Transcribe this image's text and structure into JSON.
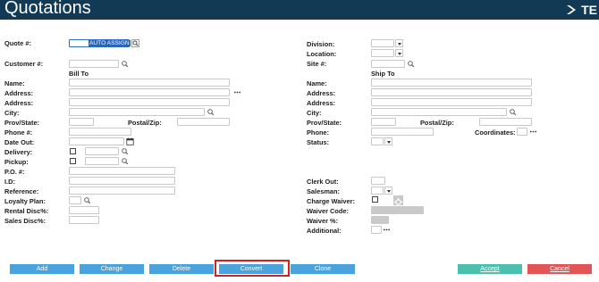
{
  "header": {
    "title": "Quotations",
    "logo_text": "TE"
  },
  "left": {
    "quote_label": "Quote #:",
    "quote_value": "AUTO ASSIGN",
    "customer_label": "Customer #:",
    "bill_to_heading": "Bill To",
    "name_label": "Name:",
    "address1_label": "Address:",
    "address2_label": "Address:",
    "city_label": "City:",
    "prov_label": "Prov/State:",
    "postal_label": "Postal/Zip:",
    "phone_label": "Phone #:",
    "date_out_label": "Date Out:",
    "delivery_label": "Delivery:",
    "pickup_label": "Pickup:",
    "po_label": "P.O. #:",
    "id_label": "I.D:",
    "reference_label": "Reference:",
    "loyalty_label": "Loyalty Plan:",
    "rental_disc_label": "Rental Disc%:",
    "sales_disc_label": "Sales Disc%:"
  },
  "right": {
    "division_label": "Division:",
    "location_label": "Location:",
    "site_label": "Site #:",
    "ship_to_heading": "Ship To",
    "name_label": "Name:",
    "address1_label": "Address:",
    "address2_label": "Address:",
    "city_label": "City:",
    "prov_label": "Prov/State:",
    "postal_label": "Postal/Zip:",
    "phone_label": "Phone:",
    "coordinates_label": "Coordinates:",
    "status_label": "Status:",
    "clerk_out_label": "Clerk Out:",
    "salesman_label": "Salesman:",
    "charge_waiver_label": "Charge Waiver:",
    "waiver_code_label": "Waiver Code:",
    "waiver_pct_label": "Waiver %:",
    "additional_label": "Additional:"
  },
  "buttons": {
    "add": "Add",
    "change": "Change",
    "delete": "Delete",
    "convert": "Convert",
    "clone": "Clone",
    "accept": "Accept",
    "cancel": "Cancel"
  },
  "colors": {
    "header_bg": "#123a55",
    "button_blue": "#4aa3dd",
    "button_teal": "#4dc0ad",
    "button_red": "#e05555",
    "highlight_border": "#d81e1e",
    "selection": "#2a65b5"
  },
  "icons": {
    "search": "search-icon",
    "ellipsis": "ellipsis-icon",
    "calendar": "calendar-icon",
    "gear": "gear-icon",
    "dropdown": "chevron-down-icon"
  }
}
